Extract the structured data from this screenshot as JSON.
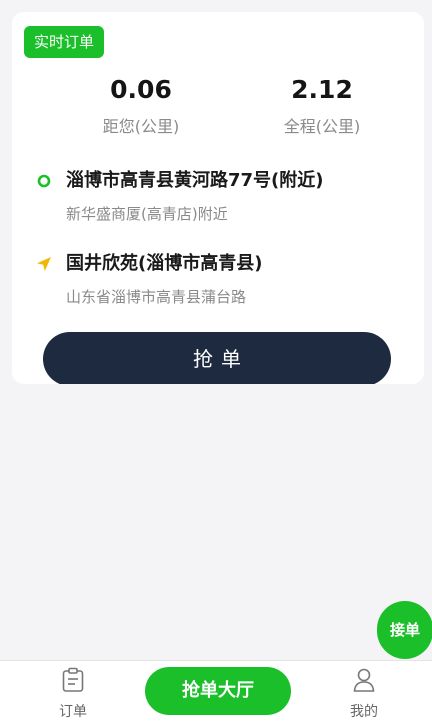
{
  "order_card": {
    "tag": "实时订单",
    "distance_to_you": {
      "value": "0.06",
      "label": "距您(公里)"
    },
    "total_distance": {
      "value": "2.12",
      "label": "全程(公里)"
    },
    "pickup": {
      "icon": "pickup-dot-icon",
      "address": "淄博市高青县黄河路77号(附近)",
      "detail": "新华盛商厦(高青店)附近"
    },
    "destination": {
      "icon": "navigation-arrow-icon",
      "address": "国井欣苑(淄博市高青县)",
      "detail": "山东省淄博市高青县蒲台路"
    },
    "grab_button": "抢单"
  },
  "accept_fab": "接单",
  "tabbar": {
    "orders": {
      "icon": "clipboard-icon",
      "label": "订单"
    },
    "hall": {
      "label": "抢单大厅"
    },
    "mine": {
      "icon": "user-icon",
      "label": "我的"
    }
  },
  "colors": {
    "accent_green": "#1bbf2a",
    "button_navy": "#1e2a40",
    "background": "#f4f4f6"
  }
}
